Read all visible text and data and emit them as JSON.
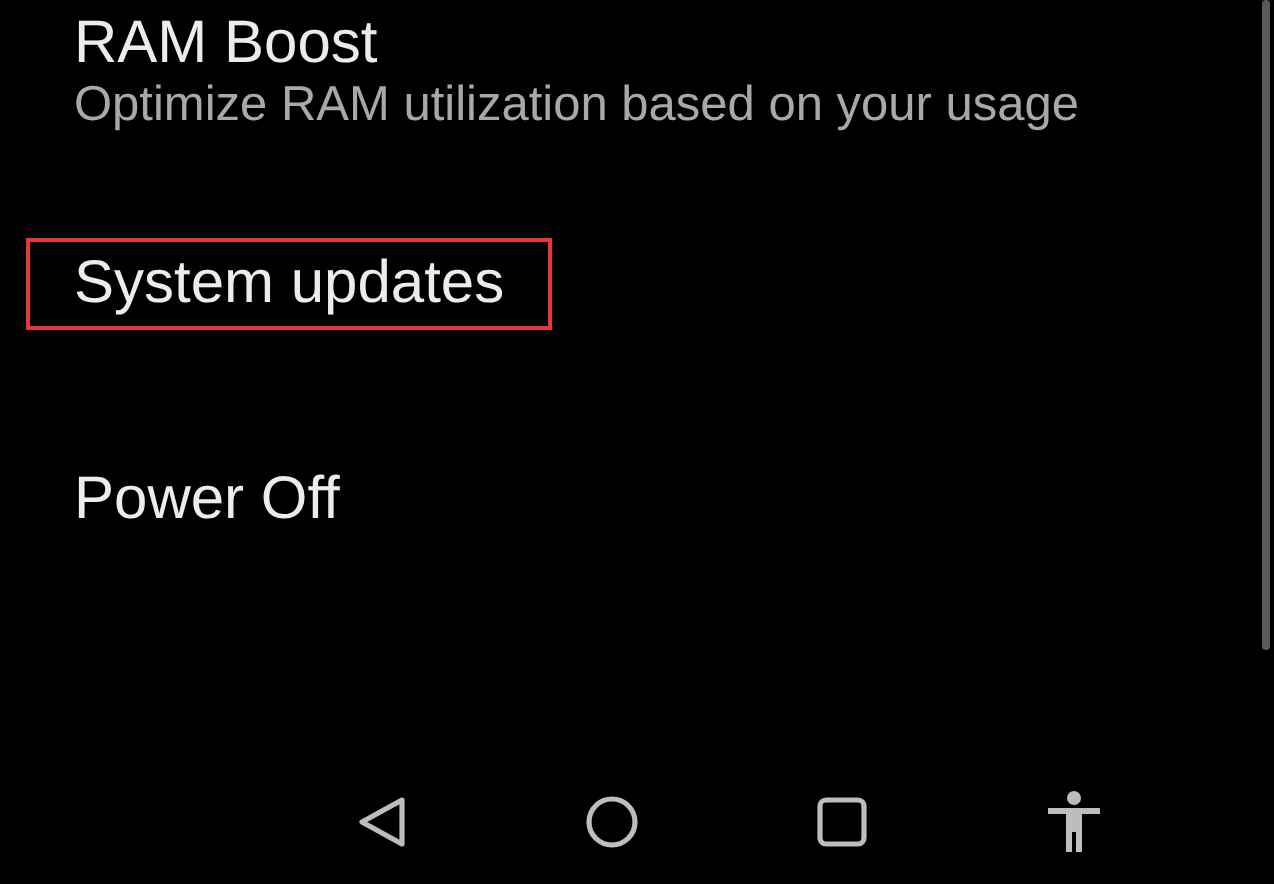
{
  "items": [
    {
      "title": "RAM Boost",
      "subtitle": "Optimize RAM utilization based on your usage",
      "highlighted": false
    },
    {
      "title": "System updates",
      "highlighted": true
    },
    {
      "title": "Power Off",
      "highlighted": false
    }
  ]
}
